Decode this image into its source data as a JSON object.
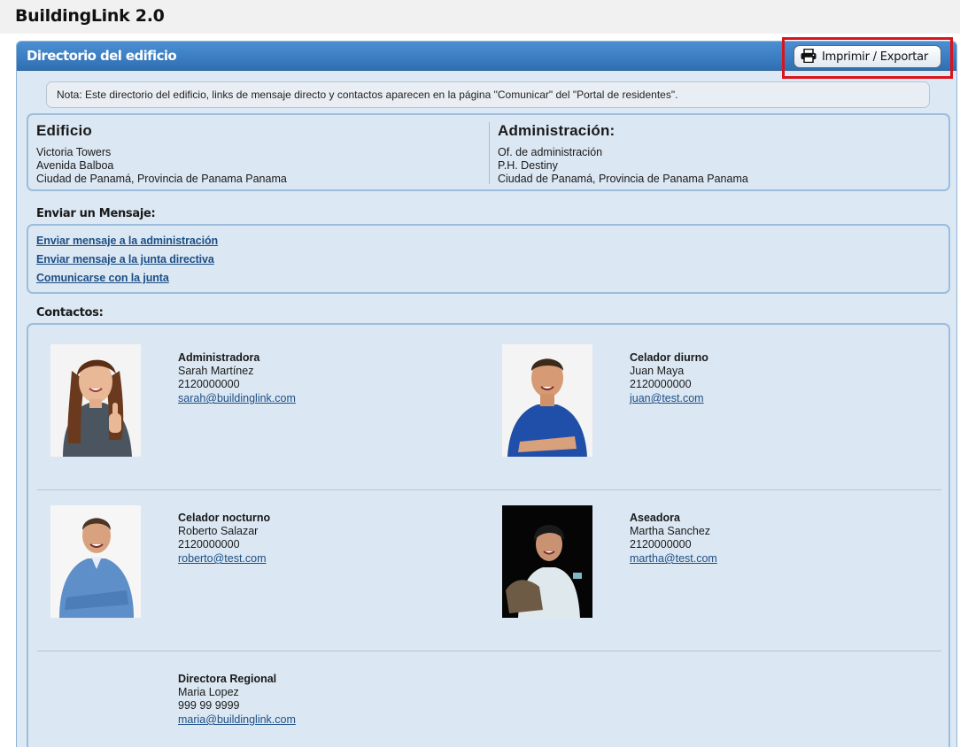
{
  "app": {
    "title": "BuildingLink 2.0"
  },
  "panel": {
    "title": "Directorio del edificio",
    "print_button_label": "Imprimir / Exportar",
    "print_icon": "printer-icon"
  },
  "note": "Nota: Este directorio del edificio, links de mensaje directo y contactos aparecen en la página \"Comunicar\" del \"Portal de residentes\".",
  "building": {
    "heading": "Edificio",
    "lines": [
      "Victoria Towers",
      "Avenida Balboa",
      "Ciudad de Panamá, Provincia de Panama Panama"
    ]
  },
  "management": {
    "heading": "Administración:",
    "lines": [
      "Of. de administración",
      "P.H. Destiny",
      "Ciudad de Panamá, Provincia de Panama Panama"
    ]
  },
  "messages": {
    "label": "Enviar un Mensaje:",
    "links": [
      "Enviar mensaje a la administración",
      "Enviar mensaje a la junta directiva",
      "Comunicarse con la junta"
    ]
  },
  "contacts": {
    "label": "Contactos:",
    "items": [
      {
        "role": "Administradora",
        "name": "Sarah Martínez",
        "phone": "2120000000",
        "email": "sarah@buildinglink.com"
      },
      {
        "role": "Celador diurno",
        "name": "Juan Maya",
        "phone": "2120000000",
        "email": "juan@test.com"
      },
      {
        "role": "Celador nocturno",
        "name": "Roberto Salazar",
        "phone": "2120000000",
        "email": "roberto@test.com"
      },
      {
        "role": "Aseadora",
        "name": "Martha Sanchez",
        "phone": "2120000000",
        "email": "martha@test.com"
      },
      {
        "role": "Directora Regional",
        "name": "Maria Lopez",
        "phone": "999 99 9999",
        "email": "maria@buildinglink.com"
      }
    ]
  },
  "colors": {
    "accent": "#2f6fb2",
    "panel_bg": "#dce8f3",
    "link": "#1d4f86",
    "highlight": "#d9141c"
  }
}
